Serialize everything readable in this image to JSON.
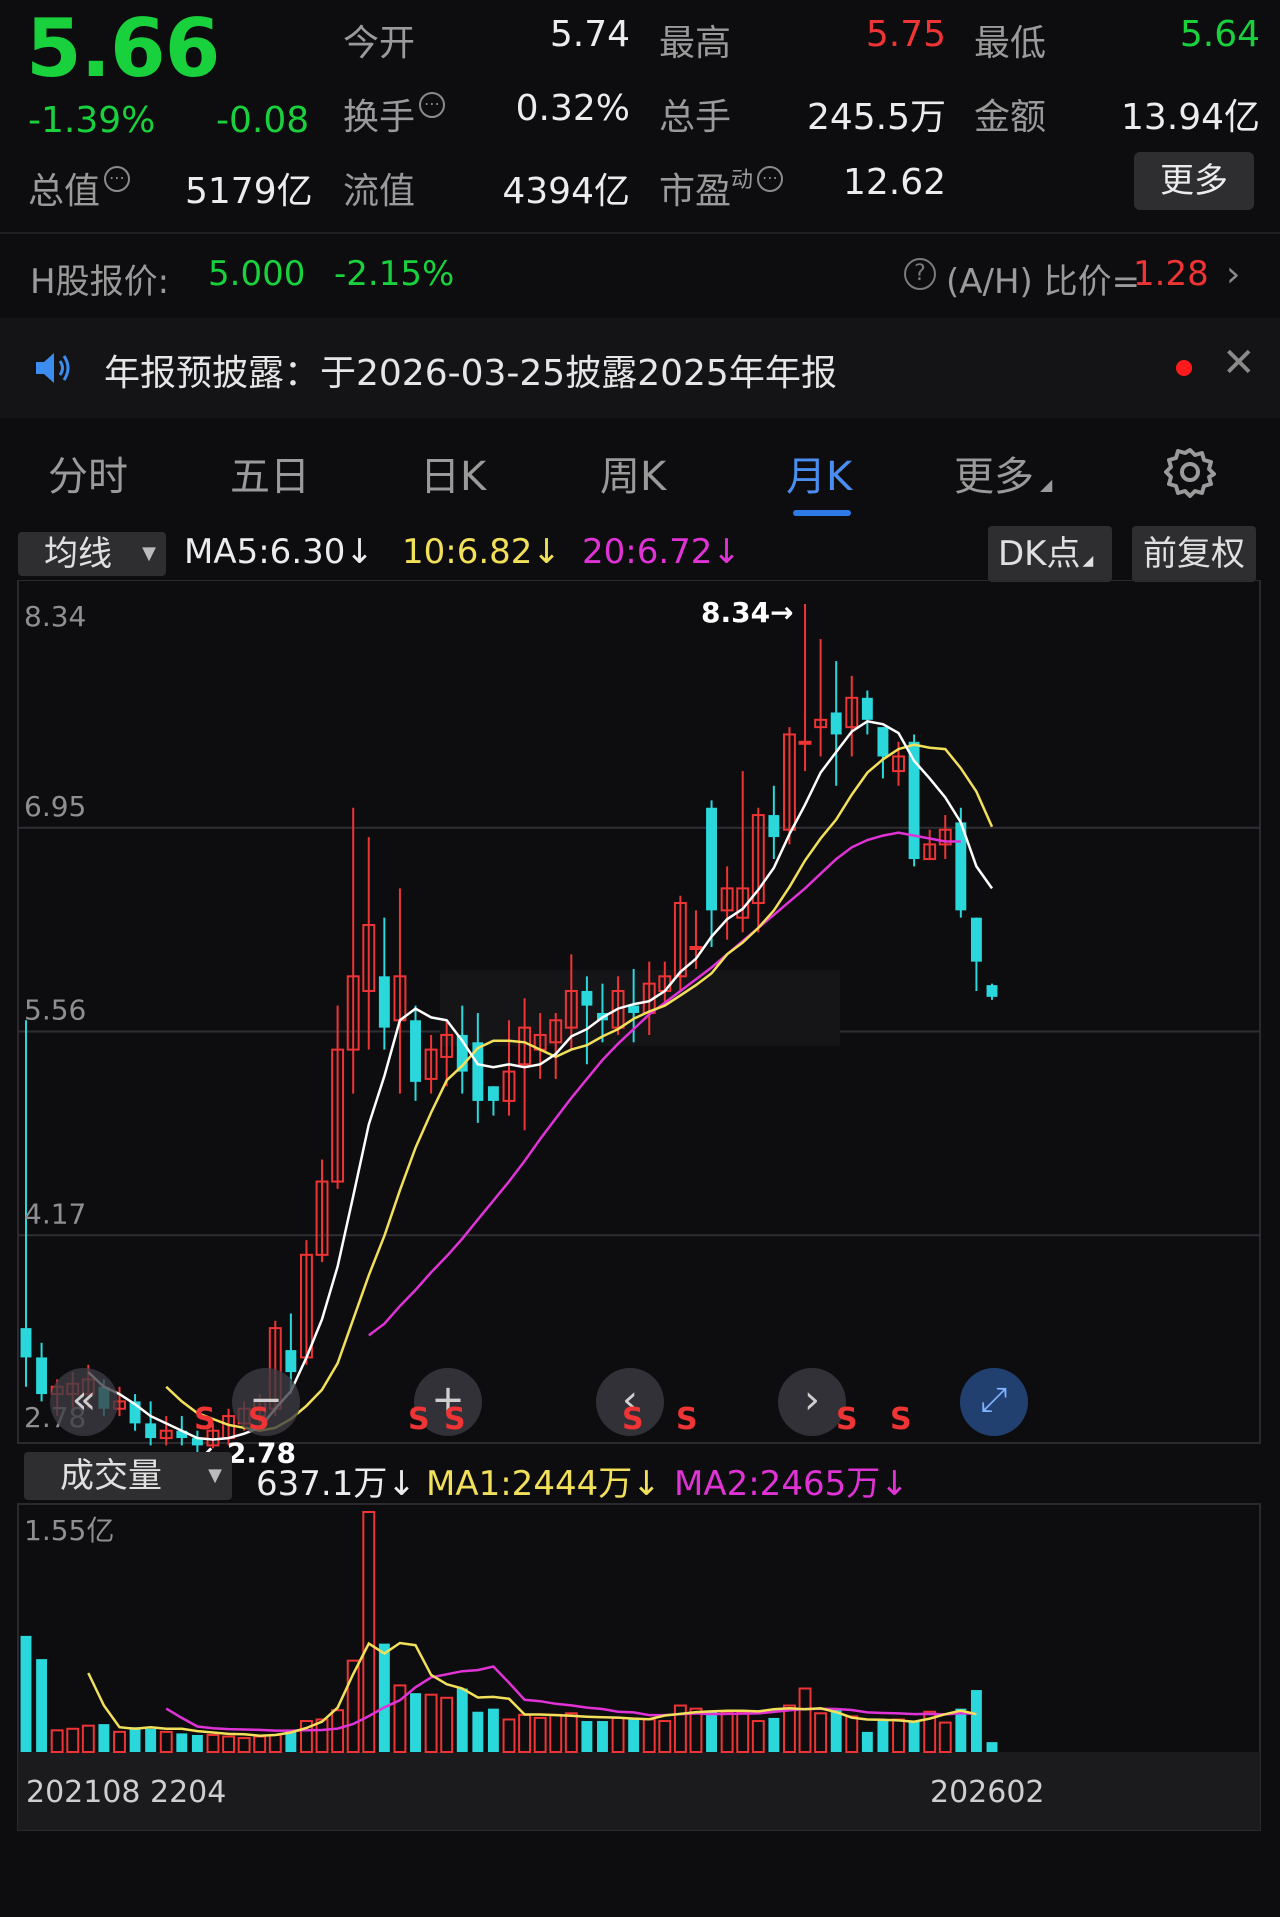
{
  "quote": {
    "price": "5.66",
    "change_pct": "-1.39%",
    "change": "-0.08",
    "rows": [
      {
        "l1": "今开",
        "v1": "5.74",
        "l2": "最高",
        "v2": "5.75",
        "l3": "最低",
        "v3": "5.64"
      },
      {
        "l1": "换手",
        "v1": "0.32%",
        "l2": "总手",
        "v2": "245.5万",
        "l3": "金额",
        "v3": "13.94亿"
      },
      {
        "l1": "流值",
        "v1": "4394亿",
        "l2": "市盈",
        "l2_sup": "动",
        "v2": "12.62"
      }
    ],
    "total_cap_label": "总值",
    "total_cap": "5179亿",
    "more": "更多",
    "info_icon": "info-circle-icon",
    "colors": {
      "up": "#ee3434",
      "down": "#19d13d"
    }
  },
  "hshare": {
    "label": "H股报价:",
    "price": "5.000",
    "pct": "-2.15%",
    "ah_label": "(A/H) 比价=",
    "ah_value": "1.28"
  },
  "notice": {
    "text": "年报预披露：于2026-03-25披露2025年年报",
    "icon": "speaker-icon"
  },
  "tabs": [
    {
      "label": "分时",
      "active": false
    },
    {
      "label": "五日",
      "active": false
    },
    {
      "label": "日K",
      "active": false
    },
    {
      "label": "周K",
      "active": false
    },
    {
      "label": "月K",
      "active": true
    },
    {
      "label": "更多",
      "active": false
    }
  ],
  "indicators": {
    "ma_select": "均线",
    "ma5": "MA5:6.30",
    "ma10": "10:6.82",
    "ma20": "20:6.72",
    "dk_btn": "DK点",
    "fq_btn": "前复权",
    "vol_select": "成交量",
    "vol_value": "637.1万",
    "vol_ma1": "MA1:2444万",
    "vol_ma2": "MA2:2465万",
    "ma_colors": {
      "ma5": "#ffffff",
      "ma10": "#f2e05a",
      "ma20": "#e033d6"
    }
  },
  "chart_data": [
    {
      "type": "candlestick",
      "title": "",
      "y_ticks": [
        "8.34",
        "6.95",
        "5.56",
        "4.17",
        "2.78"
      ],
      "ylim": [
        2.78,
        8.34
      ],
      "max_label": "8.34",
      "min_label": "2.78",
      "x_labels": [
        "202108",
        "2204",
        "202602"
      ],
      "markers": [
        "S",
        "S",
        "S",
        "S",
        "S",
        "S",
        "S",
        "S"
      ],
      "colors": {
        "up": "#ee3434",
        "down": "#2ad8dc"
      },
      "candles": [
        {
          "o": 3.4,
          "h": 5.5,
          "l": 3.0,
          "c": 3.2
        },
        {
          "o": 3.2,
          "h": 3.3,
          "l": 2.9,
          "c": 2.95
        },
        {
          "o": 2.95,
          "h": 3.05,
          "l": 2.8,
          "c": 3.0
        },
        {
          "o": 2.95,
          "h": 3.1,
          "l": 2.85,
          "c": 3.02
        },
        {
          "o": 2.95,
          "h": 3.15,
          "l": 2.85,
          "c": 3.05
        },
        {
          "o": 3.0,
          "h": 3.05,
          "l": 2.8,
          "c": 2.85
        },
        {
          "o": 2.85,
          "h": 3.0,
          "l": 2.8,
          "c": 2.9
        },
        {
          "o": 2.9,
          "h": 2.95,
          "l": 2.7,
          "c": 2.75
        },
        {
          "o": 2.75,
          "h": 2.9,
          "l": 2.6,
          "c": 2.65
        },
        {
          "o": 2.65,
          "h": 2.8,
          "l": 2.6,
          "c": 2.7
        },
        {
          "o": 2.7,
          "h": 2.8,
          "l": 2.6,
          "c": 2.65
        },
        {
          "o": 2.65,
          "h": 2.7,
          "l": 2.55,
          "c": 2.6
        },
        {
          "o": 2.6,
          "h": 2.75,
          "l": 2.58,
          "c": 2.7
        },
        {
          "o": 2.65,
          "h": 2.85,
          "l": 2.6,
          "c": 2.8
        },
        {
          "o": 2.75,
          "h": 2.9,
          "l": 2.7,
          "c": 2.85
        },
        {
          "o": 2.8,
          "h": 2.95,
          "l": 2.75,
          "c": 2.9
        },
        {
          "o": 2.85,
          "h": 3.45,
          "l": 2.8,
          "c": 3.4
        },
        {
          "o": 3.25,
          "h": 3.5,
          "l": 2.95,
          "c": 3.1
        },
        {
          "o": 3.2,
          "h": 4.0,
          "l": 3.15,
          "c": 3.9
        },
        {
          "o": 3.9,
          "h": 4.55,
          "l": 3.85,
          "c": 4.4
        },
        {
          "o": 4.4,
          "h": 5.6,
          "l": 4.35,
          "c": 5.3
        },
        {
          "o": 5.3,
          "h": 6.95,
          "l": 5.0,
          "c": 5.8
        },
        {
          "o": 5.7,
          "h": 6.75,
          "l": 5.3,
          "c": 6.15
        },
        {
          "o": 5.8,
          "h": 6.2,
          "l": 5.3,
          "c": 5.45
        },
        {
          "o": 5.5,
          "h": 6.4,
          "l": 5.0,
          "c": 5.8
        },
        {
          "o": 5.5,
          "h": 5.6,
          "l": 4.95,
          "c": 5.08
        },
        {
          "o": 5.1,
          "h": 5.4,
          "l": 5.0,
          "c": 5.3
        },
        {
          "o": 5.25,
          "h": 5.5,
          "l": 5.05,
          "c": 5.4
        },
        {
          "o": 5.4,
          "h": 5.6,
          "l": 5.0,
          "c": 5.15
        },
        {
          "o": 5.35,
          "h": 5.55,
          "l": 4.8,
          "c": 4.95
        },
        {
          "o": 5.05,
          "h": 5.05,
          "l": 4.85,
          "c": 4.95
        },
        {
          "o": 4.95,
          "h": 5.5,
          "l": 4.85,
          "c": 5.15
        },
        {
          "o": 5.2,
          "h": 5.65,
          "l": 4.75,
          "c": 5.45
        },
        {
          "o": 5.3,
          "h": 5.55,
          "l": 5.1,
          "c": 5.4
        },
        {
          "o": 5.35,
          "h": 5.55,
          "l": 5.1,
          "c": 5.5
        },
        {
          "o": 5.45,
          "h": 5.95,
          "l": 5.3,
          "c": 5.7
        },
        {
          "o": 5.7,
          "h": 5.8,
          "l": 5.2,
          "c": 5.6
        },
        {
          "o": 5.55,
          "h": 5.75,
          "l": 5.35,
          "c": 5.5
        },
        {
          "o": 5.45,
          "h": 5.8,
          "l": 5.4,
          "c": 5.7
        },
        {
          "o": 5.6,
          "h": 5.85,
          "l": 5.35,
          "c": 5.55
        },
        {
          "o": 5.55,
          "h": 5.9,
          "l": 5.4,
          "c": 5.75
        },
        {
          "o": 5.7,
          "h": 5.9,
          "l": 5.6,
          "c": 5.8
        },
        {
          "o": 5.8,
          "h": 6.35,
          "l": 5.7,
          "c": 6.3
        },
        {
          "o": 6.0,
          "h": 6.25,
          "l": 5.85,
          "c": 6.0
        },
        {
          "o": 6.95,
          "h": 7.0,
          "l": 6.0,
          "c": 6.25
        },
        {
          "o": 6.25,
          "h": 6.55,
          "l": 6.05,
          "c": 6.4
        },
        {
          "o": 6.2,
          "h": 7.2,
          "l": 6.1,
          "c": 6.4
        },
        {
          "o": 6.3,
          "h": 6.95,
          "l": 6.1,
          "c": 6.9
        },
        {
          "o": 6.9,
          "h": 7.1,
          "l": 6.6,
          "c": 6.75
        },
        {
          "o": 6.8,
          "h": 7.5,
          "l": 6.7,
          "c": 7.45
        },
        {
          "o": 7.4,
          "h": 8.34,
          "l": 7.2,
          "c": 7.4
        },
        {
          "o": 7.5,
          "h": 8.1,
          "l": 7.3,
          "c": 7.55
        },
        {
          "o": 7.6,
          "h": 7.95,
          "l": 7.1,
          "c": 7.45
        },
        {
          "o": 7.5,
          "h": 7.85,
          "l": 7.3,
          "c": 7.7
        },
        {
          "o": 7.7,
          "h": 7.75,
          "l": 7.45,
          "c": 7.55
        },
        {
          "o": 7.5,
          "h": 7.5,
          "l": 7.15,
          "c": 7.3
        },
        {
          "o": 7.2,
          "h": 7.4,
          "l": 7.1,
          "c": 7.3
        },
        {
          "o": 7.4,
          "h": 7.45,
          "l": 6.55,
          "c": 6.6
        },
        {
          "o": 6.6,
          "h": 6.8,
          "l": 6.6,
          "c": 6.7
        },
        {
          "o": 6.7,
          "h": 6.9,
          "l": 6.6,
          "c": 6.8
        },
        {
          "o": 6.85,
          "h": 6.95,
          "l": 6.2,
          "c": 6.25
        },
        {
          "o": 6.2,
          "h": 6.2,
          "l": 5.7,
          "c": 5.9
        },
        {
          "o": 5.74,
          "h": 5.75,
          "l": 5.64,
          "c": 5.66
        }
      ],
      "ma5": [
        null,
        null,
        null,
        null,
        3.1,
        3.0,
        2.95,
        2.88,
        2.8,
        2.75,
        2.7,
        2.65,
        2.64,
        2.65,
        2.68,
        2.72,
        2.85,
        2.97,
        3.2,
        3.46,
        3.82,
        4.3,
        4.79,
        5.12,
        5.5,
        5.58,
        5.52,
        5.5,
        5.36,
        5.2,
        5.18,
        5.2,
        5.18,
        5.2,
        5.27,
        5.39,
        5.44,
        5.52,
        5.58,
        5.61,
        5.63,
        5.7,
        5.83,
        5.92,
        6.07,
        6.19,
        6.26,
        6.39,
        6.54,
        6.77,
        6.97,
        7.19,
        7.33,
        7.47,
        7.54,
        7.52,
        7.46,
        7.27,
        7.15,
        7.02,
        6.85,
        6.55,
        6.4
      ],
      "ma10": [
        null,
        null,
        null,
        null,
        null,
        null,
        null,
        null,
        null,
        3.0,
        2.9,
        2.82,
        2.78,
        2.74,
        2.72,
        2.7,
        2.72,
        2.78,
        2.87,
        2.98,
        3.16,
        3.46,
        3.76,
        4.03,
        4.34,
        4.63,
        4.87,
        5.09,
        5.19,
        5.31,
        5.36,
        5.36,
        5.35,
        5.3,
        5.25,
        5.3,
        5.33,
        5.39,
        5.44,
        5.51,
        5.56,
        5.6,
        5.67,
        5.74,
        5.82,
        5.95,
        6.03,
        6.13,
        6.25,
        6.41,
        6.59,
        6.74,
        6.87,
        7.04,
        7.19,
        7.28,
        7.35,
        7.38,
        7.36,
        7.35,
        7.22,
        7.06,
        6.82
      ],
      "ma20": [
        null,
        null,
        null,
        null,
        null,
        null,
        null,
        null,
        null,
        null,
        null,
        null,
        null,
        null,
        null,
        null,
        null,
        null,
        null,
        3.35,
        3.43,
        3.55,
        3.66,
        3.78,
        3.89,
        4.01,
        4.14,
        4.27,
        4.4,
        4.54,
        4.69,
        4.83,
        4.97,
        5.1,
        5.23,
        5.34,
        5.44,
        5.54,
        5.62,
        5.7,
        5.78,
        5.86,
        5.95,
        6.04,
        6.13,
        6.22,
        6.31,
        6.4,
        6.5,
        6.6,
        6.68,
        6.73,
        6.76,
        6.78,
        6.76,
        6.74,
        6.72,
        6.72
      ],
      "ma_offset_last": true
    },
    {
      "type": "bar",
      "title": "",
      "y_ticks": [
        "1.55亿"
      ],
      "ylim": [
        0,
        15500
      ],
      "unit": "万",
      "volumes": [
        7500,
        6000,
        1400,
        1500,
        1700,
        1800,
        1300,
        1600,
        1500,
        1300,
        1200,
        1100,
        1100,
        1000,
        900,
        1000,
        1100,
        1400,
        2000,
        2100,
        2700,
        5900,
        15500,
        7000,
        4300,
        3800,
        3700,
        3500,
        4100,
        2600,
        2800,
        2100,
        2400,
        2200,
        2400,
        2500,
        2000,
        2000,
        2200,
        2100,
        2100,
        2000,
        3000,
        2800,
        2600,
        2600,
        2600,
        2000,
        2200,
        3000,
        4100,
        2500,
        2800,
        2300,
        1300,
        2100,
        2100,
        2000,
        2600,
        1900,
        2800,
        4000,
        637
      ],
      "ma1": [
        null,
        null,
        null,
        null,
        5100,
        3000,
        1600,
        1500,
        1600,
        1500,
        1500,
        1350,
        1260,
        1170,
        1150,
        1050,
        1100,
        1260,
        1550,
        1960,
        2860,
        5040,
        7000,
        6360,
        7040,
        6900,
        4980,
        4380,
        4100,
        3520,
        3560,
        3440,
        2420,
        2420,
        2380,
        2340,
        2280,
        2240,
        2220,
        2160,
        2120,
        2360,
        2460,
        2580,
        2620,
        2660,
        2660,
        2620,
        2760,
        2820,
        2760,
        2820,
        2580,
        2220,
        2100,
        2080,
        2040,
        1960,
        2160,
        2440,
        2670,
        2440
      ],
      "ma2": [
        null,
        null,
        null,
        null,
        null,
        null,
        null,
        null,
        null,
        2800,
        2200,
        1650,
        1530,
        1480,
        1450,
        1430,
        1380,
        1380,
        1400,
        1420,
        1510,
        1810,
        2320,
        2890,
        3340,
        4180,
        4820,
        5020,
        5220,
        5290,
        5520,
        4470,
        3370,
        3280,
        3110,
        3010,
        2870,
        2780,
        2600,
        2560,
        2380,
        2380,
        2450,
        2490,
        2450,
        2460,
        2480,
        2490,
        2590,
        2690,
        2780,
        2790,
        2780,
        2710,
        2560,
        2520,
        2490,
        2450,
        2460,
        2430,
        2500,
        2465
      ]
    }
  ]
}
